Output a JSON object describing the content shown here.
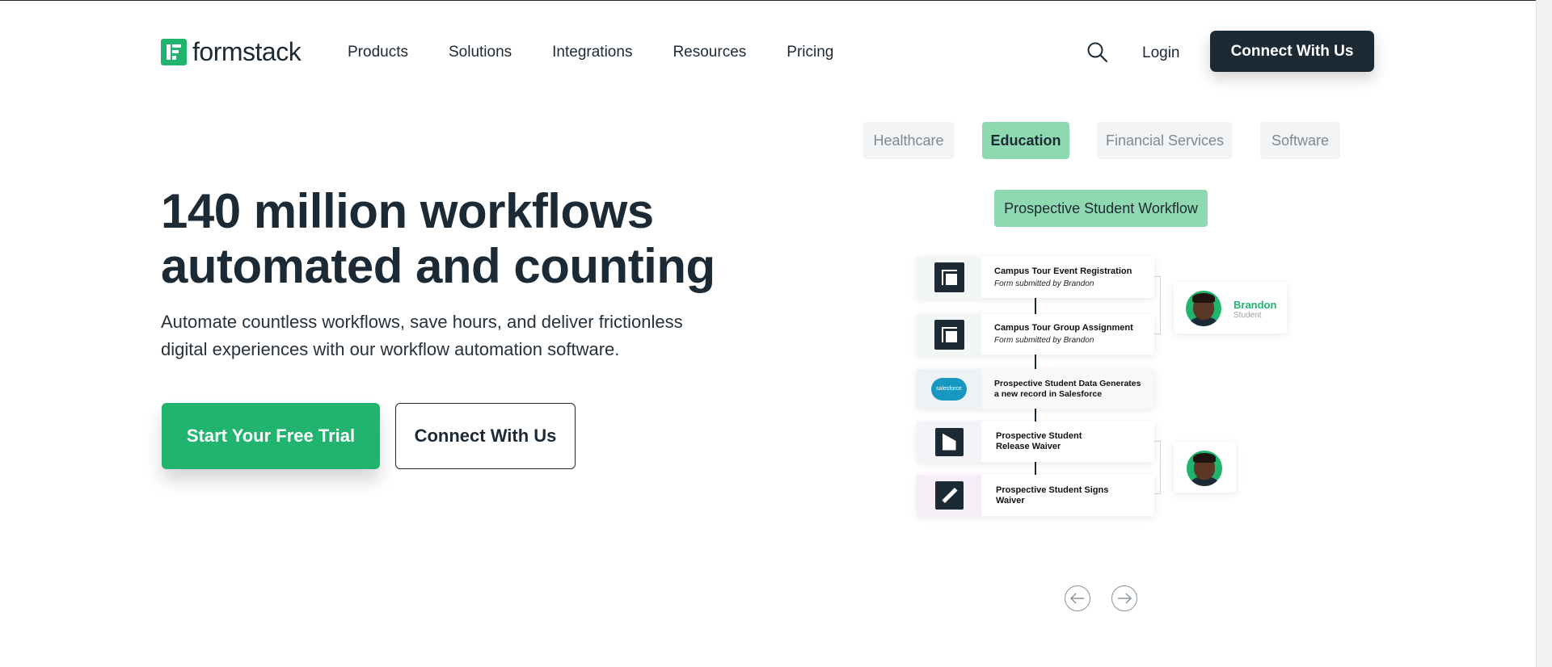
{
  "header": {
    "logo_text": "formstack",
    "nav": [
      "Products",
      "Solutions",
      "Integrations",
      "Resources",
      "Pricing"
    ],
    "login": "Login",
    "cta": "Connect With Us"
  },
  "hero": {
    "title_line1": "140 million workflows",
    "title_line2": "automated and counting",
    "subtitle_line1": "Automate countless workflows, save hours, and deliver frictionless",
    "subtitle_line2": "digital experiences with our workflow automation software.",
    "primary_cta": "Start Your Free Trial",
    "secondary_cta": "Connect With Us"
  },
  "showcase": {
    "tabs": [
      "Healthcare",
      "Education",
      "Financial Services",
      "Software"
    ],
    "active_tab": "Education",
    "workflow_title": "Prospective Student Workflow",
    "steps": [
      {
        "title": "Campus Tour Event Registration",
        "detail": "Form submitted by Brandon",
        "icon": "form-icon"
      },
      {
        "title": "Campus Tour Group Assignment",
        "detail": "Form submitted by Brandon",
        "icon": "form-icon"
      },
      {
        "title": "Prospective Student Data Generates",
        "title2": "a new record in Salesforce",
        "icon": "salesforce-icon",
        "badge": "salesforce"
      },
      {
        "title": "Prospective Student",
        "title2": "Release Waiver",
        "icon": "document-icon"
      },
      {
        "title": "Prospective Student Signs",
        "title2": "Waiver",
        "icon": "pen-icon"
      }
    ],
    "user": {
      "name": "Brandon",
      "role": "Student"
    }
  },
  "colors": {
    "brand_green": "#21b46e",
    "dark": "#1c2a35",
    "tab_active": "#8fd9b1"
  }
}
